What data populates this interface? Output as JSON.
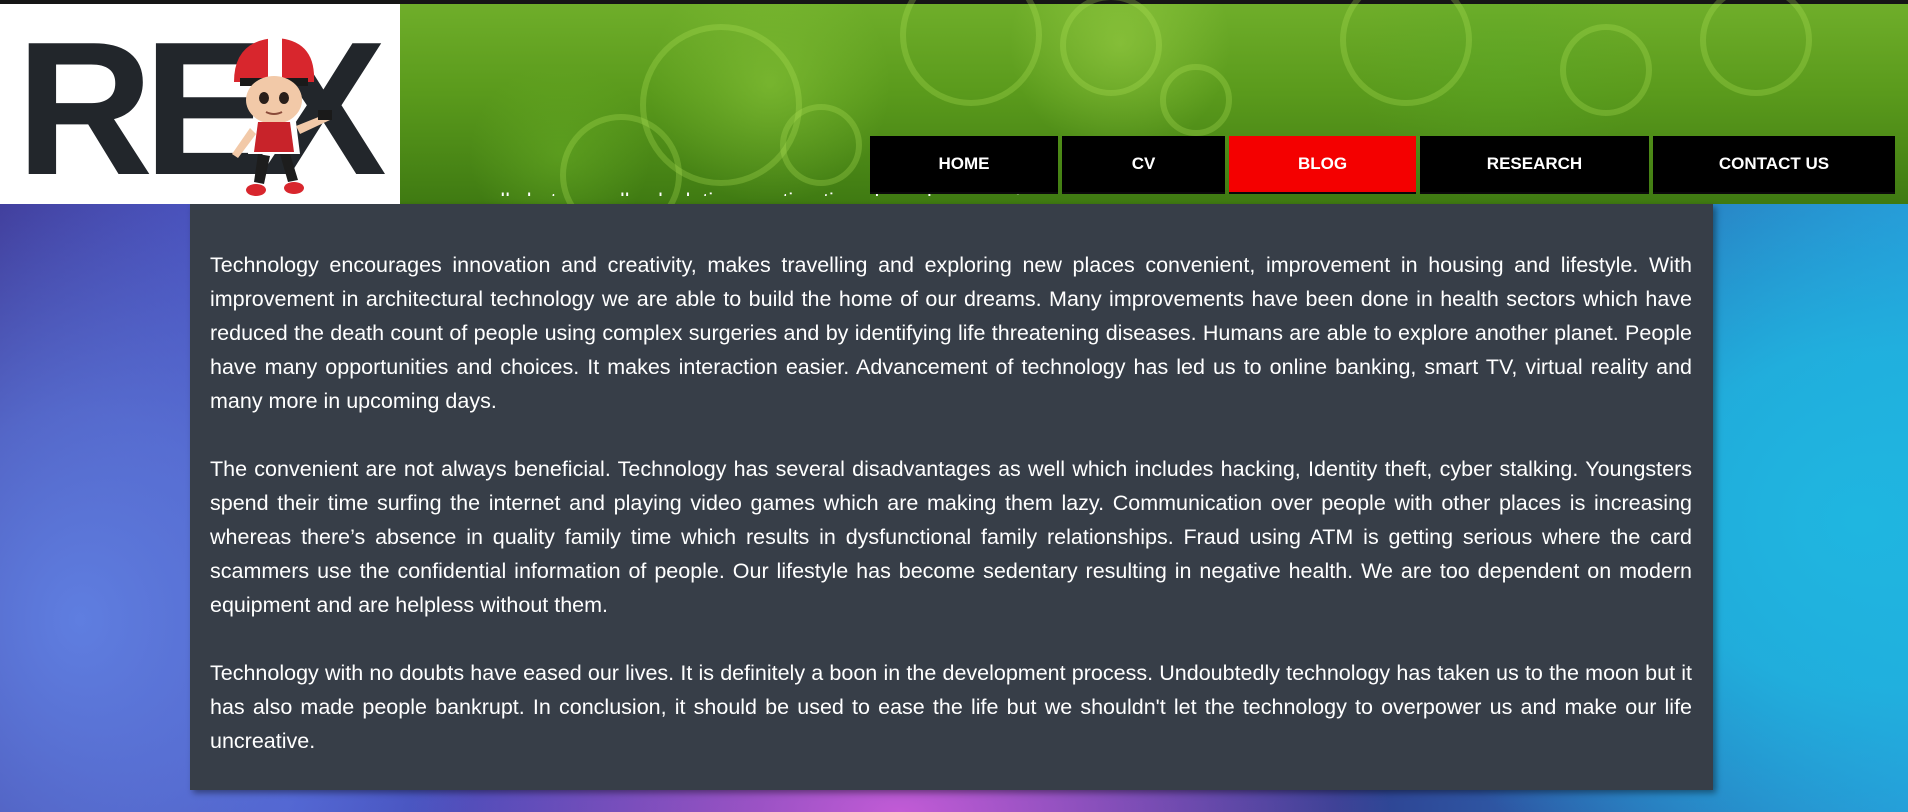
{
  "logo": {
    "text": "REX"
  },
  "nav": [
    {
      "label": "HOME",
      "active": false
    },
    {
      "label": "CV",
      "active": false
    },
    {
      "label": "BLOG",
      "active": true
    },
    {
      "label": "RESEARCH",
      "active": false
    },
    {
      "label": "CONTACT US",
      "active": false
    }
  ],
  "colors": {
    "nav_bg": "#000000",
    "nav_active": "#f40000",
    "header_green": "#5a9a1c",
    "content_bg": "#373e48"
  },
  "article": {
    "partial_line": "calculations were done manually but now all calculations, estimations have been easier.",
    "paragraphs": [
      "Technology encourages innovation and creativity, makes travelling and exploring new places convenient, improvement in housing and lifestyle. With improvement in architectural technology we are able to build the home of our dreams. Many improvements have been done in health sectors which have reduced the death count of people using complex surgeries and by identifying life threatening diseases. Humans are able to explore another planet. People have many opportunities and choices. It makes interaction easier. Advancement of technology has led us to online banking, smart TV, virtual reality and many more in upcoming days.",
      "The convenient are not always beneficial. Technology has several disadvantages as well which includes hacking, Identity theft, cyber stalking. Youngsters spend their time surfing the internet and playing video games which are making them lazy. Communication over people with other places is increasing whereas there’s absence in quality family time which results in dysfunctional family relationships. Fraud using ATM is getting serious where the card scammers use the confidential information of people. Our lifestyle has become sedentary resulting in negative health. We are too dependent on modern equipment and are helpless without them.",
      "Technology with no doubts have eased our lives. It is definitely a boon in the development process. Undoubtedly technology has taken us to the moon but it has also made people bankrupt. In conclusion, it should be used to ease the life but we shouldn't let the technology to overpower us and make our life uncreative."
    ]
  }
}
